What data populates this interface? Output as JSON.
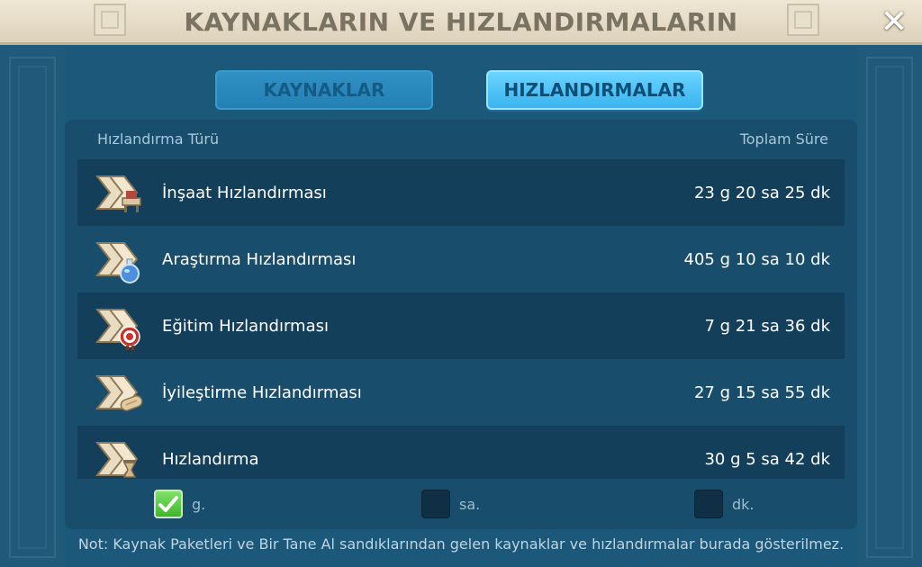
{
  "header": {
    "title": "KAYNAKLARIN VE HIZLANDIRMALARIN",
    "close_label": "✕"
  },
  "tabs": {
    "resources": "KAYNAKLAR",
    "speedups": "HIZLANDIRMALAR",
    "active": "speedups"
  },
  "table": {
    "col_type": "Hızlandırma Türü",
    "col_total": "Toplam Süre",
    "rows": [
      {
        "name": "İnşaat Hızlandırması",
        "total": "23 g 20 sa 25 dk",
        "icon": "construction-speedup-icon"
      },
      {
        "name": "Araştırma Hızlandırması",
        "total": "405 g 10 sa 10 dk",
        "icon": "research-speedup-icon"
      },
      {
        "name": "Eğitim Hızlandırması",
        "total": "7 g 21 sa 36 dk",
        "icon": "training-speedup-icon"
      },
      {
        "name": "İyileştirme Hızlandırması",
        "total": "27 g 15 sa 55 dk",
        "icon": "healing-speedup-icon"
      },
      {
        "name": "Hızlandırma",
        "total": "30 g 5 sa 42 dk",
        "icon": "universal-speedup-icon"
      }
    ]
  },
  "filters": {
    "days": {
      "label": "g.",
      "checked": true
    },
    "hours": {
      "label": "sa.",
      "checked": false
    },
    "minutes": {
      "label": "dk.",
      "checked": false
    }
  },
  "note": "Not: Kaynak Paketleri ve Bir Tane Al sandıklarından gelen kaynaklar ve hızlandırmalar burada gösterilmez.",
  "colors": {
    "header_bg": "#e6dcc6",
    "panel_bg": "#1c587a",
    "row_dark": "#133f5b",
    "active_tab": "#4cc3f7",
    "check_green": "#4cc13a"
  }
}
